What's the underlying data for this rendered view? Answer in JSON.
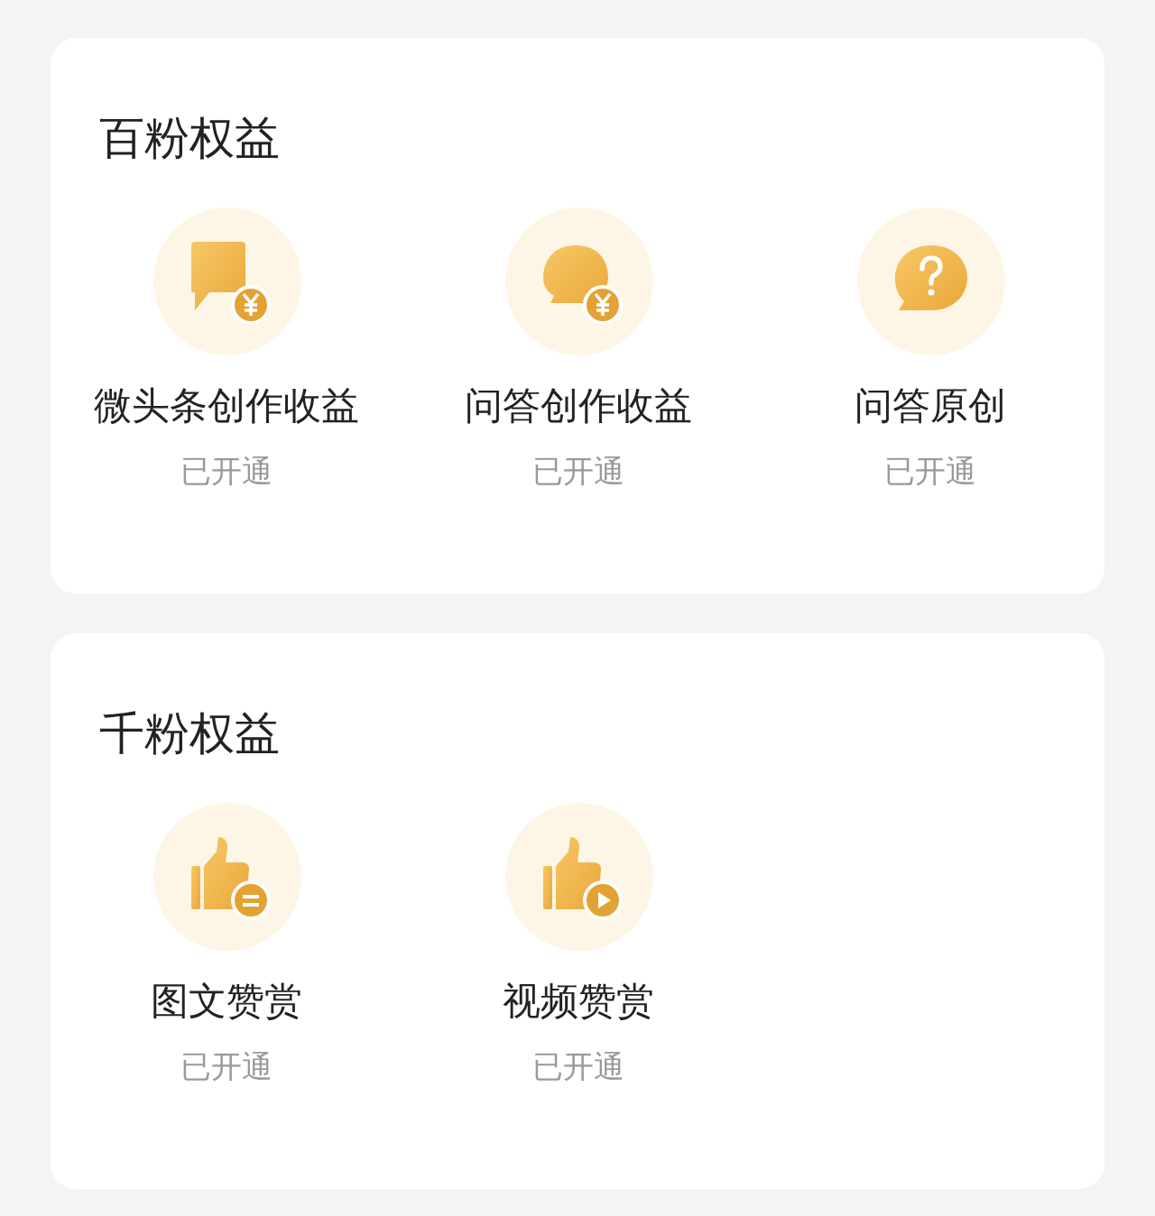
{
  "sections": [
    {
      "title": "百粉权益",
      "items": [
        {
          "kind": "square-yuan",
          "label": "微头条创作收益",
          "status": "已开通"
        },
        {
          "kind": "round-yuan",
          "label": "问答创作收益",
          "status": "已开通"
        },
        {
          "kind": "question",
          "label": "问答原创",
          "status": "已开通"
        }
      ]
    },
    {
      "title": "千粉权益",
      "items": [
        {
          "kind": "thumb-lines",
          "label": "图文赞赏",
          "status": "已开通"
        },
        {
          "kind": "thumb-play",
          "label": "视频赞赏",
          "status": "已开通"
        }
      ]
    }
  ]
}
